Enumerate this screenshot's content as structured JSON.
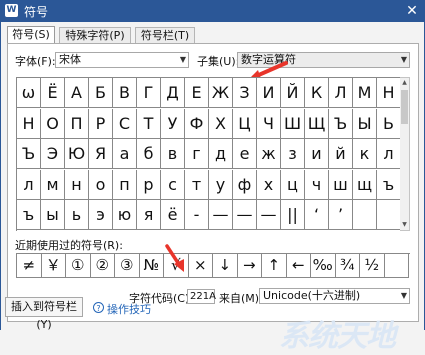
{
  "window": {
    "title": "符号",
    "icon": "wps-icon",
    "close_glyph": "✕"
  },
  "tabs": [
    {
      "label": "符号(S)",
      "active": true
    },
    {
      "label": "特殊字符(P)",
      "active": false
    },
    {
      "label": "符号栏(T)",
      "active": false
    }
  ],
  "font": {
    "label": "字体(F):",
    "value": "宋体"
  },
  "subset": {
    "label": "子集(U):",
    "value": "数字运算符"
  },
  "grid": {
    "rows": [
      [
        "ω",
        "Ё",
        "А",
        "Б",
        "В",
        "Г",
        "Д",
        "Е",
        "Ж",
        "З",
        "И",
        "Й",
        "К",
        "Л",
        "М",
        "Н"
      ],
      [
        "Н",
        "О",
        "П",
        "Р",
        "С",
        "Т",
        "У",
        "Ф",
        "Х",
        "Ц",
        "Ч",
        "Ш",
        "Щ",
        "Ъ",
        "Ы",
        "Ь"
      ],
      [
        "Ъ",
        "Э",
        "Ю",
        "Я",
        "а",
        "б",
        "в",
        "г",
        "д",
        "е",
        "ж",
        "з",
        "и",
        "й",
        "к",
        "л"
      ],
      [
        "л",
        "м",
        "н",
        "о",
        "п",
        "р",
        "с",
        "т",
        "у",
        "ф",
        "х",
        "ц",
        "ч",
        "ш",
        "щ",
        "ъ"
      ],
      [
        "ъ",
        "ы",
        "ь",
        "э",
        "ю",
        "я",
        "ё",
        "-",
        "—",
        "—",
        "—",
        "||",
        "‘",
        "’",
        "",
        ""
      ]
    ]
  },
  "recent": {
    "label": "近期使用过的符号(R):",
    "symbols": [
      "≠",
      "￥",
      "①",
      "②",
      "③",
      "№",
      "√",
      "×",
      "↓",
      "→",
      "↑",
      "←",
      "‰",
      "¾",
      "½",
      ""
    ]
  },
  "char_code": {
    "label": "字符代码(C):",
    "value": "221A"
  },
  "from": {
    "label": "来自(M):",
    "value": "Unicode(十六进制)"
  },
  "buttons": {
    "insert": "插入到符号栏(Y)",
    "tips": "操作技巧"
  },
  "watermark": "系统天地",
  "colors": {
    "titlebar": "#2b5797",
    "accent_arrow": "#e8352b"
  }
}
